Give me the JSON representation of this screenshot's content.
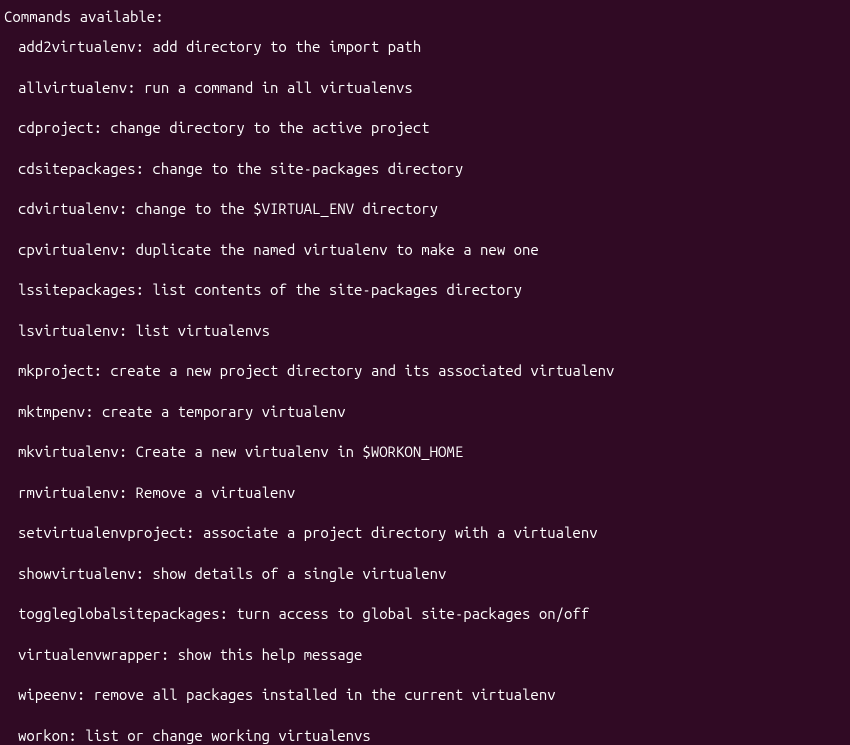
{
  "header": "Commands available:",
  "commands": [
    {
      "name": "add2virtualenv",
      "desc": "add directory to the import path"
    },
    {
      "name": "allvirtualenv",
      "desc": "run a command in all virtualenvs"
    },
    {
      "name": "cdproject",
      "desc": "change directory to the active project"
    },
    {
      "name": "cdsitepackages",
      "desc": "change to the site-packages directory"
    },
    {
      "name": "cdvirtualenv",
      "desc": "change to the $VIRTUAL_ENV directory"
    },
    {
      "name": "cpvirtualenv",
      "desc": "duplicate the named virtualenv to make a new one"
    },
    {
      "name": "lssitepackages",
      "desc": "list contents of the site-packages directory"
    },
    {
      "name": "lsvirtualenv",
      "desc": "list virtualenvs"
    },
    {
      "name": "mkproject",
      "desc": "create a new project directory and its associated virtualenv"
    },
    {
      "name": "mktmpenv",
      "desc": "create a temporary virtualenv"
    },
    {
      "name": "mkvirtualenv",
      "desc": "Create a new virtualenv in $WORKON_HOME"
    },
    {
      "name": "rmvirtualenv",
      "desc": "Remove a virtualenv"
    },
    {
      "name": "setvirtualenvproject",
      "desc": "associate a project directory with a virtualenv"
    },
    {
      "name": "showvirtualenv",
      "desc": "show details of a single virtualenv"
    },
    {
      "name": "toggleglobalsitepackages",
      "desc": "turn access to global site-packages on/off"
    },
    {
      "name": "virtualenvwrapper",
      "desc": "show this help message"
    },
    {
      "name": "wipeenv",
      "desc": "remove all packages installed in the current virtualenv"
    },
    {
      "name": "workon",
      "desc": "list or change working virtualenvs"
    }
  ]
}
